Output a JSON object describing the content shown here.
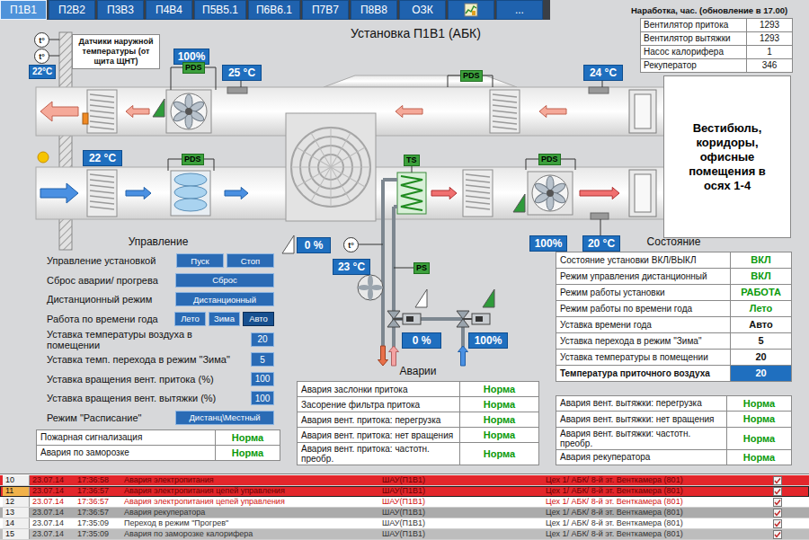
{
  "tabs": [
    {
      "kind": "text",
      "label": "П1В1",
      "selected": true
    },
    {
      "kind": "text",
      "label": "П2В2",
      "selected": false
    },
    {
      "kind": "text",
      "label": "П3В3",
      "selected": false
    },
    {
      "kind": "text",
      "label": "П4В4",
      "selected": false
    },
    {
      "kind": "text",
      "label": "П5В5.1",
      "selected": false
    },
    {
      "kind": "text",
      "label": "П6В6.1",
      "selected": false
    },
    {
      "kind": "text",
      "label": "П7В7",
      "selected": false
    },
    {
      "kind": "text",
      "label": "П8В8",
      "selected": false
    },
    {
      "kind": "text",
      "label": "ОЗК",
      "selected": false
    },
    {
      "kind": "icon",
      "label": "",
      "selected": false
    },
    {
      "kind": "text",
      "label": "...",
      "selected": false
    }
  ],
  "runtime": {
    "title": "Наработка, час. (обновление в 17.00)",
    "rows": [
      {
        "label": "Вентилятор притока",
        "value": "1293"
      },
      {
        "label": "Вентилятор вытяжки",
        "value": "1293"
      },
      {
        "label": "Насос калорифера",
        "value": "1"
      },
      {
        "label": "Рекуператор",
        "value": "346"
      }
    ]
  },
  "title": "Установка П1В1 (АБК)",
  "diagram": {
    "outdoor": {
      "label": "Датчики наружной температуры (от щита ЩНТ)",
      "sensors": [
        "t°",
        "t°"
      ],
      "reading": "22°C"
    },
    "room": "Вестибюль, коридоры, офисные помещения в осях 1-4",
    "exhaust_fan": {
      "speed": "100%",
      "running": true
    },
    "exhaust_temp": "25 °C",
    "return_temp": "24 °C",
    "intake_temp": "22 °C",
    "supply_fan": {
      "speed": "100%",
      "running": true
    },
    "supply_temp": "20 °C",
    "bypass": {
      "reading": "0 %",
      "level": 0
    },
    "water": {
      "sensor": "t°",
      "reading": "23 °C"
    },
    "heater_sensor": "TS",
    "pressure_switch": "PS",
    "pds": [
      "PDS",
      "PDS",
      "PDS",
      "PDS"
    ],
    "valves": [
      {
        "reading": "0 %",
        "level": 0
      },
      {
        "reading": "100%",
        "level": 1
      }
    ]
  },
  "control": {
    "title": "Управление",
    "rows": [
      {
        "label": "Управление установкой",
        "kind": "pair",
        "buttons": [
          {
            "label": "Пуск"
          },
          {
            "label": "Стоп"
          }
        ]
      },
      {
        "label": "Сброс аварии/ прогрева",
        "kind": "wide",
        "buttons": [
          {
            "label": "Сброс"
          }
        ]
      },
      {
        "label": "Дистанционный режим",
        "kind": "wide",
        "buttons": [
          {
            "label": "Дистанционный"
          }
        ]
      },
      {
        "label": "Работа по времени года",
        "kind": "choice",
        "buttons": [
          {
            "label": "Лето",
            "selected": false
          },
          {
            "label": "Зима",
            "selected": false
          },
          {
            "label": "Авто",
            "selected": true
          }
        ]
      },
      {
        "label": "Уставка температуры воздуха в помещении",
        "kind": "field",
        "value": "20"
      },
      {
        "label": "Уставка темп. перехода в режим \"Зима\"",
        "kind": "field",
        "value": "5"
      },
      {
        "label": "Уставка вращения вент. притока (%)",
        "kind": "field",
        "value": "100"
      },
      {
        "label": "Уставка вращения вент. вытяжки (%)",
        "kind": "field",
        "value": "100"
      },
      {
        "label": "Режим \"Расписание\"",
        "kind": "wide",
        "buttons": [
          {
            "label": "Дистанц\\Местный"
          }
        ]
      }
    ]
  },
  "alarms_left": [
    {
      "label": "Пожарная сигнализация",
      "value": "Норма"
    },
    {
      "label": "Авария по заморозке",
      "value": "Норма"
    }
  ],
  "alarms": {
    "title": "Аварии",
    "rows": [
      {
        "label": "Авария заслонки притока",
        "value": "Норма"
      },
      {
        "label": "Засорение фильтра притока",
        "value": "Норма"
      },
      {
        "label": "Авария вент. притока: перегрузка",
        "value": "Норма"
      },
      {
        "label": "Авария вент. притока: нет вращения",
        "value": "Норма"
      },
      {
        "label": "Авария вент. притока: частотн. преобр.",
        "value": "Норма"
      }
    ]
  },
  "state": {
    "title": "Состояние",
    "rows": [
      {
        "label": "Состояние установки ВКЛ/ВЫКЛ",
        "value": "ВКЛ",
        "color": "#0a9a0a",
        "highlight": false
      },
      {
        "label": "Режим управления дистанционный",
        "value": "ВКЛ",
        "color": "#0a9a0a",
        "highlight": false
      },
      {
        "label": "Режим работы установки",
        "value": "РАБОТА",
        "color": "#0a9a0a",
        "highlight": false
      },
      {
        "label": "Режим работы по времени года",
        "value": "Лето",
        "color": "#0a9a0a",
        "highlight": false
      },
      {
        "label": "Уставка времени года",
        "value": "Авто",
        "color": "#111111",
        "highlight": false
      },
      {
        "label": "Уставка перехода в режим \"Зима\"",
        "value": "5",
        "color": "#111111",
        "highlight": false
      },
      {
        "label": "Уставка температуры в помещении",
        "value": "20",
        "color": "#111111",
        "highlight": false
      },
      {
        "label": "Температура приточного воздуха",
        "value": "20",
        "color": "#ffffff",
        "highlight": true
      }
    ]
  },
  "alarms_right": [
    {
      "label": "Авария вент. вытяжки: перегрузка",
      "value": "Норма"
    },
    {
      "label": "Авария вент. вытяжки: нет вращения",
      "value": "Норма"
    },
    {
      "label": "Авария вент. вытяжки: частотн. преобр.",
      "value": "Норма"
    },
    {
      "label": "Авария рекуператора",
      "value": "Норма"
    }
  ],
  "log": {
    "rows": [
      {
        "n": "10",
        "date": "23.07.14",
        "time": "17:36:58",
        "text": "Авария электропитания",
        "source": "ШАУ(П1В1)",
        "place": "Цех 1/ АБК/ 8-й эт. Венткамера (801)",
        "color": "#e3262b",
        "text_color": "#6a0000",
        "selected": false
      },
      {
        "n": "11",
        "date": "23.07.14",
        "time": "17:36:57",
        "text": "Авария электропитания цепей управления",
        "source": "ШАУ(П1В1)",
        "place": "Цех 1/ АБК/ 8-й эт. Венткамера (801)",
        "color": "#e3262b",
        "text_color": "#6a0000",
        "selected": true
      },
      {
        "n": "12",
        "date": "23.07.14",
        "time": "17:36:57",
        "text": "Авария электропитания цепей управления",
        "source": "ШАУ(П1В1)",
        "place": "Цех 1/ АБК/ 8-й эт. Венткамера (801)",
        "color": "#ffffff",
        "text_color": "#d01010",
        "selected": false
      },
      {
        "n": "13",
        "date": "23.07.14",
        "time": "17:36:57",
        "text": "Авария рекуператора",
        "source": "ШАУ(П1В1)",
        "place": "Цех 1/ АБК/ 8-й эт. Венткамера (801)",
        "color": "#ababab",
        "text_color": "#333333",
        "selected": false
      },
      {
        "n": "14",
        "date": "23.07.14",
        "time": "17:35:09",
        "text": "Переход в режим \"Прогрев\"",
        "source": "ШАУ(П1В1)",
        "place": "Цех 1/ АБК/ 8-й эт. Венткамера (801)",
        "color": "#ffffff",
        "text_color": "#333333",
        "selected": false
      },
      {
        "n": "15",
        "date": "23.07.14",
        "time": "17:35:09",
        "text": "Авария по заморозке калорифера",
        "source": "ШАУ(П1В1)",
        "place": "Цех 1/ АБК/ 8-й эт. Венткамера (801)",
        "color": "#bdbdbd",
        "text_color": "#333333",
        "selected": false
      }
    ]
  }
}
